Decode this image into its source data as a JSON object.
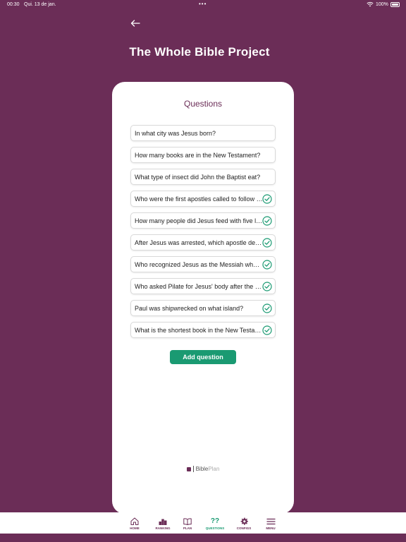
{
  "status_bar": {
    "time": "00:30",
    "date": "Qui. 13 de jan.",
    "dots": "•••",
    "battery": "100%"
  },
  "header": {
    "back_icon": "arrow-left-icon",
    "title": "The Whole Bible Project"
  },
  "card": {
    "title": "Questions",
    "questions": [
      {
        "text": "In what city was Jesus born?",
        "completed": false
      },
      {
        "text": "How many books are in the New Testament?",
        "completed": false
      },
      {
        "text": "What type of insect did John the Baptist eat?",
        "completed": false
      },
      {
        "text": "Who were the first apostles called to follow Jesus?",
        "completed": true
      },
      {
        "text": "How many people did Jesus feed with five loaves?",
        "completed": true
      },
      {
        "text": "After Jesus was arrested, which apostle denied him?",
        "completed": true
      },
      {
        "text": "Who recognized Jesus as the Messiah when he was a baby?",
        "completed": true
      },
      {
        "text": "Who asked Pilate for Jesus' body after the crucifixion?",
        "completed": true
      },
      {
        "text": "Paul was shipwrecked on what island?",
        "completed": true
      },
      {
        "text": "What is the shortest book in the New Testament?",
        "completed": true
      }
    ],
    "add_button": "Add question",
    "brand_name": "Bible",
    "brand_suffix": "Plan"
  },
  "nav": {
    "items": [
      {
        "label": "HOME",
        "icon": "home-icon"
      },
      {
        "label": "RANKING",
        "icon": "ranking-icon"
      },
      {
        "label": "PLAN",
        "icon": "book-icon"
      },
      {
        "label": "QUESTIONS",
        "icon": "question-marks-icon",
        "symbol": "??"
      },
      {
        "label": "CONFIGS",
        "icon": "gear-icon"
      },
      {
        "label": "MENU",
        "icon": "menu-icon"
      }
    ],
    "active": "QUESTIONS"
  },
  "colors": {
    "background": "#6b2d57",
    "accent": "#1a9a72",
    "card": "#ffffff"
  }
}
